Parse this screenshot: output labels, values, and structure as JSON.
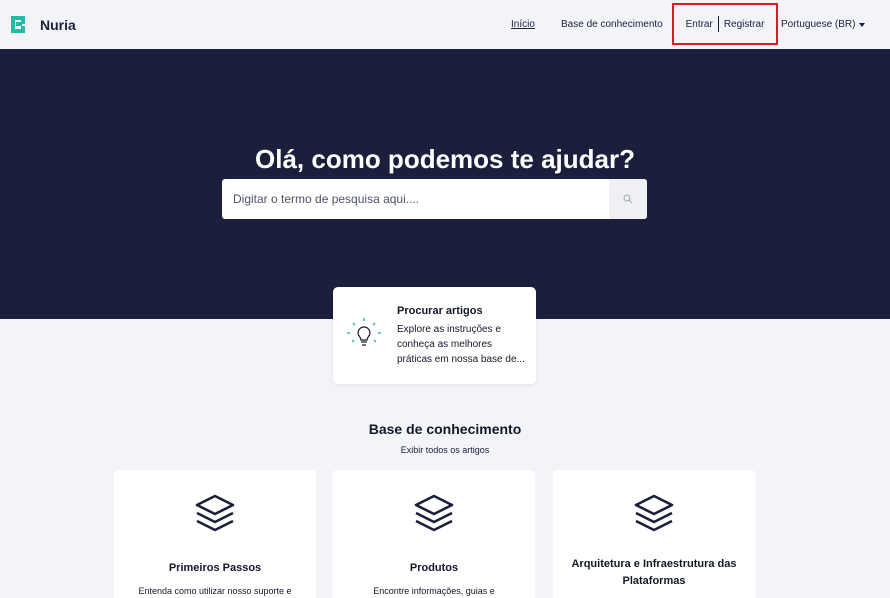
{
  "navbar": {
    "brand": "Nuria",
    "links": [
      "Início",
      "Base de conhecimento"
    ],
    "login": "Entrar",
    "register": "Registrar",
    "language": "Portuguese (BR)"
  },
  "hero": {
    "title": "Olá, como podemos te ajudar?",
    "search_placeholder": "Digitar o termo de pesquisa aqui...."
  },
  "feature_card": {
    "title": "Procurar artigos",
    "description": "Explore as instruções e conheça as melhores práticas em nossa base de..."
  },
  "knowledge_base": {
    "title": "Base de conhecimento",
    "view_all": "Exibir todos os artigos",
    "categories": [
      {
        "title": "Primeiros Passos",
        "description": "Entenda como utilizar nosso suporte e"
      },
      {
        "title": "Produtos",
        "description": "Encontre informações, guias e"
      },
      {
        "title": "Arquitetura e Infraestrutura das Plataformas",
        "description": ""
      }
    ]
  },
  "colors": {
    "hero_bg": "#1b1f3b",
    "accent": "#2bb6a5",
    "highlight_border": "#d41c24"
  }
}
